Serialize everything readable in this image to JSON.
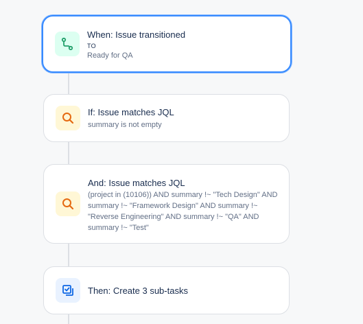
{
  "trigger": {
    "title": "When: Issue transitioned",
    "to_label": "TO",
    "status": "Ready for QA",
    "icon": "transition-icon"
  },
  "condition1": {
    "title": "If: Issue matches JQL",
    "detail": "summary is not empty",
    "icon": "search-icon"
  },
  "condition2": {
    "title": "And: Issue matches JQL",
    "detail_lines": [
      "(project in (10106)) AND summary !~ \"Tech Design\" AND",
      "summary !~ \"Framework Design\" AND summary !~",
      "\"Reverse Engineering\" AND summary !~ \"QA\" AND",
      "summary !~ \"Test\""
    ],
    "icon": "search-icon"
  },
  "action": {
    "title": "Then: Create 3 sub-tasks",
    "icon": "subtask-icon"
  },
  "colors": {
    "accent": "#388bff",
    "trigger_icon": "#22a06b",
    "condition_icon": "#e56910",
    "action_icon": "#0c66e4"
  }
}
